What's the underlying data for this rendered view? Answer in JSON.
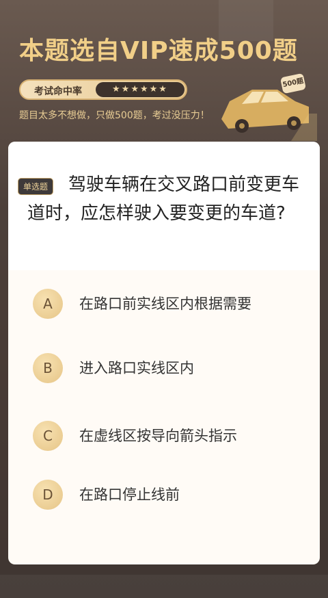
{
  "banner": {
    "title": "本题选自VIP速成500题",
    "rate_label": "考试命中率",
    "stars": "★★★★★★",
    "subtitle": "题目太多不想做，只做500题，考过没压力！",
    "bubble_label": "500题"
  },
  "question": {
    "type_badge": "单选题",
    "text": "驾驶车辆在交叉路口前变更车道时，应怎样驶入要变更的车道?",
    "options": [
      {
        "letter": "A",
        "text": "在路口前实线区内根据需要"
      },
      {
        "letter": "B",
        "text": "进入路口实线区内"
      },
      {
        "letter": "C",
        "text": "在虚线区按导向箭头指示"
      },
      {
        "letter": "D",
        "text": "在路口停止线前"
      }
    ]
  },
  "colors": {
    "accent_gold": "#f1cf88",
    "bg_dark": "#4d403a",
    "card": "#fffbf6"
  }
}
